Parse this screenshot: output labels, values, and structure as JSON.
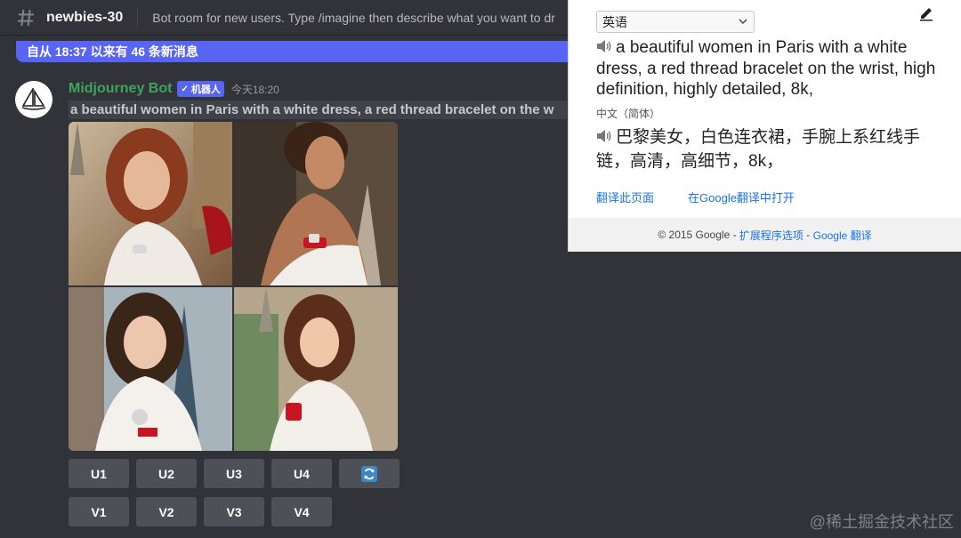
{
  "header": {
    "channel_name": "newbies-30",
    "topic": "Bot room for new users. Type /imagine then describe what you want to dr"
  },
  "new_messages_banner": "自从 18:37 以来有 46 条新消息",
  "message": {
    "author": "Midjourney Bot",
    "bot_tag": "机器人",
    "timestamp": "今天18:20",
    "prompt": "a beautiful women in Paris with a white dress, a red thread bracelet on the w"
  },
  "buttons": {
    "row1": [
      "U1",
      "U2",
      "U3",
      "U4"
    ],
    "row2": [
      "V1",
      "V2",
      "V3",
      "V4"
    ]
  },
  "translate": {
    "source_lang": "英语",
    "source_text": "a beautiful women in Paris with a white dress, a red thread bracelet on the wrist, high definition, highly detailed, 8k,",
    "target_lang_label": "中文（简体）",
    "target_text": "巴黎美女，白色连衣裙，手腕上系红线手链，高清，高细节，8k，",
    "link_translate_page": "翻译此页面",
    "link_open_google": "在Google翻译中打开",
    "footer_copyright": "© 2015 Google",
    "footer_sep1": " - ",
    "footer_ext_options": "扩展程序选项",
    "footer_sep2": " - ",
    "footer_google_translate": "Google 翻译"
  },
  "watermark": "@稀土掘金技术社区",
  "colors": {
    "discord_bg": "#313338",
    "blurple": "#5865f2",
    "bot_green": "#3ba55c",
    "button_grey": "#4e5058",
    "link_blue": "#1a73e8"
  }
}
